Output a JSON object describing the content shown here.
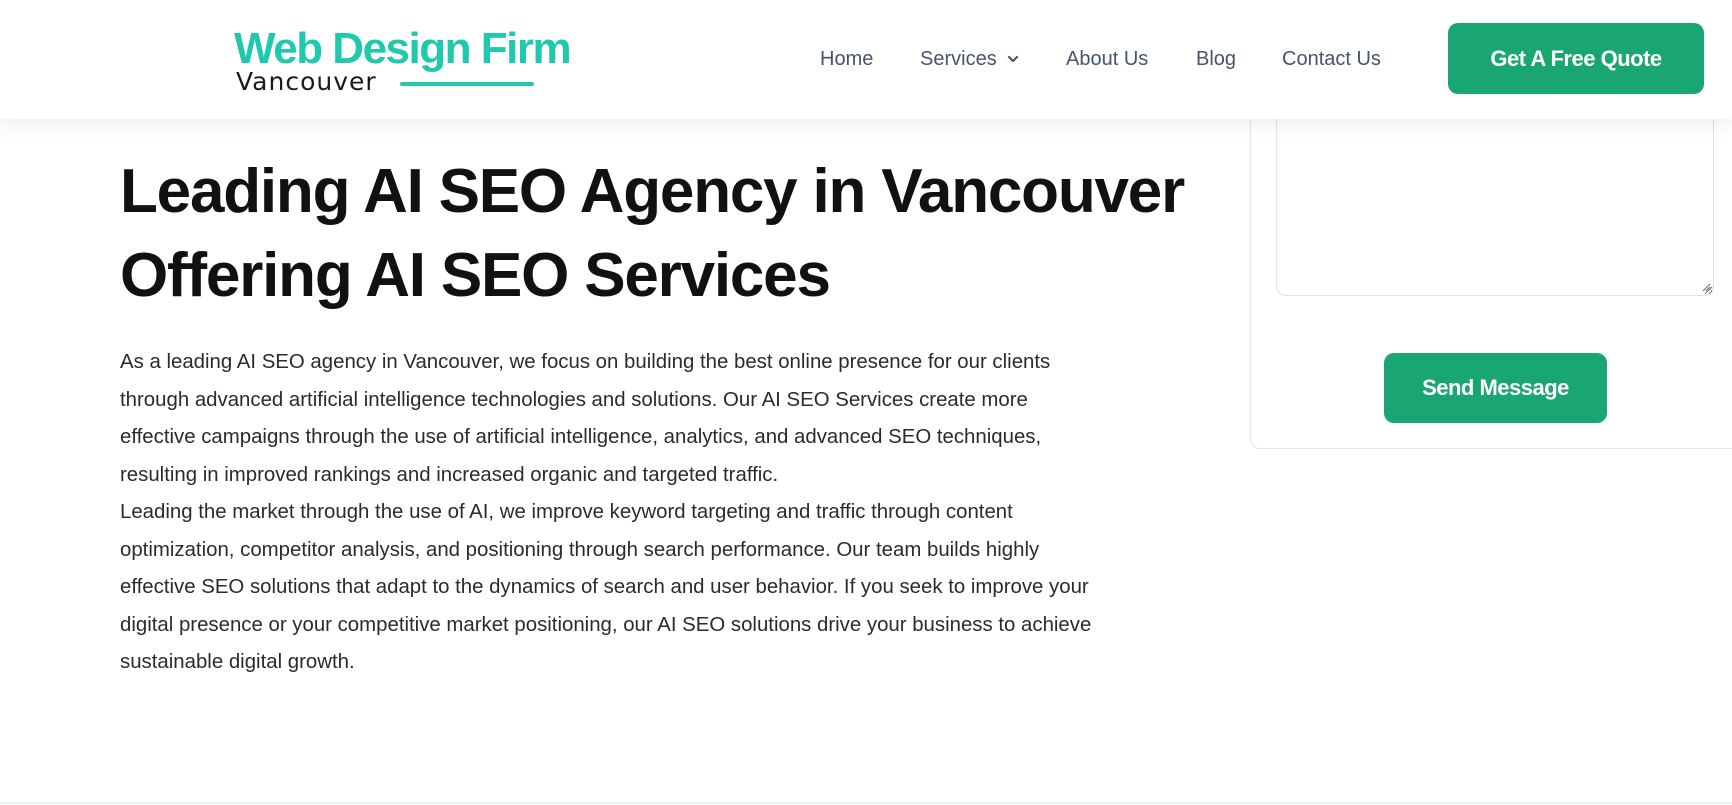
{
  "header": {
    "logo": {
      "line1": "Web Design Firm",
      "line2": "Vancouver"
    },
    "nav": [
      {
        "label": "Home"
      },
      {
        "label": "Services",
        "has_dropdown": true,
        "icon": "chevron-down-icon"
      },
      {
        "label": "About Us"
      },
      {
        "label": "Blog"
      },
      {
        "label": "Contact Us"
      }
    ],
    "cta_label": "Get A Free Quote"
  },
  "main": {
    "heading_lines": [
      "Leading AI SEO Agency in Vancouver",
      "Offering AI SEO Services"
    ],
    "paragraph1_lines": [
      "As a leading AI SEO agency in Vancouver, we focus on building the best online presence for our clients",
      "through advanced artificial intelligence technologies and solutions. Our AI SEO Services create more",
      "effective campaigns through the use of artificial intelligence, analytics, and advanced SEO techniques,",
      "resulting in improved rankings and increased organic and targeted traffic."
    ],
    "paragraph2_lines": [
      "Leading the market through the use of AI, we improve keyword targeting and traffic through content",
      "optimization, competitor analysis, and positioning through search performance. Our team builds highly",
      "effective SEO solutions that adapt to the dynamics of search and user behavior. If you seek to improve your",
      "digital presence or your competitive market positioning, our AI SEO solutions drive your business to achieve",
      "sustainable digital growth."
    ]
  },
  "form": {
    "message_value": "",
    "send_label": "Send Message"
  },
  "colors": {
    "brand_teal": "#20c9ad",
    "button_green": "#1aa673",
    "nav_text": "#46546a",
    "heading_text": "#111111",
    "body_text": "#2b2b2b"
  }
}
